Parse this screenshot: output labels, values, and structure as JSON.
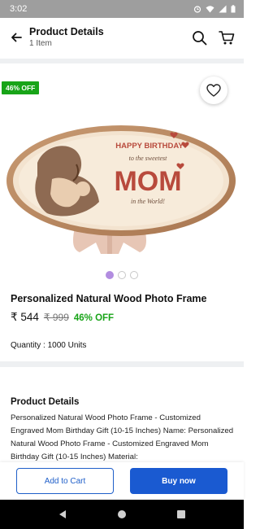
{
  "status": {
    "time": "3:02"
  },
  "header": {
    "title": "Product Details",
    "subtitle": "1 Item"
  },
  "product": {
    "discount_badge": "46% OFF",
    "name": "Personalized Natural Wood Photo Frame",
    "price": "₹ 544",
    "mrp": "₹ 999",
    "discount": "46% OFF",
    "quantity": "Quantity : 1000 Units",
    "image_text": {
      "line1": "HAPPY BIRTHDAY",
      "line2": "to the sweetest",
      "line3": "MOM",
      "line4": "in the World!"
    },
    "gallery": {
      "count": 3,
      "active_index": 0
    }
  },
  "details": {
    "title": "Product Details",
    "text": "Personalized Natural Wood Photo Frame - Customized Engraved Mom Birthday Gift (10-15 Inches) Name: Personalized Natural Wood Photo Frame - Customized Engraved Mom Birthday Gift (10-15 Inches) Material:"
  },
  "actions": {
    "add_to_cart": "Add to Cart",
    "buy_now": "Buy now"
  },
  "colors": {
    "accent": "#1a5ad1",
    "discount": "#18a418",
    "dot_active": "#b28de0"
  }
}
